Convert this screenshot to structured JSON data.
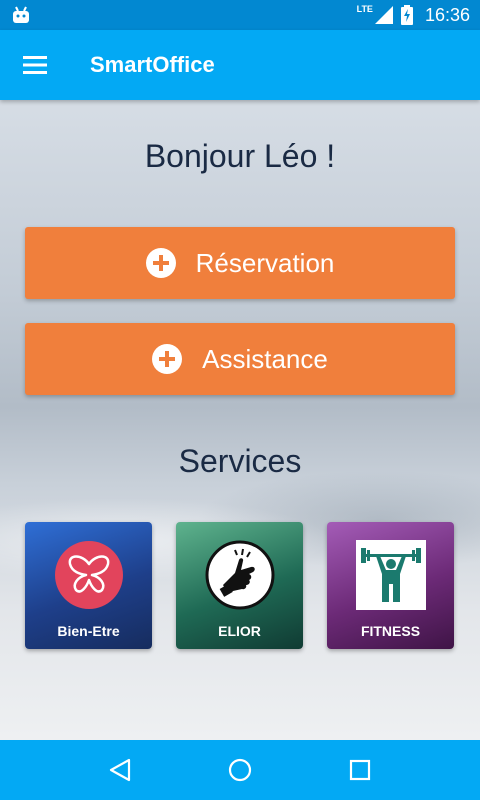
{
  "status_bar": {
    "network": "LTE",
    "time": "16:36"
  },
  "app_bar": {
    "title": "SmartOffice",
    "menu_icon": "hamburger-menu-icon"
  },
  "main": {
    "greeting": "Bonjour Léo !",
    "actions": [
      {
        "label": "Réservation",
        "icon": "plus-circle-icon"
      },
      {
        "label": "Assistance",
        "icon": "plus-circle-icon"
      }
    ],
    "services_title": "Services",
    "services": [
      {
        "label": "Bien-Etre",
        "icon": "butterfly-icon"
      },
      {
        "label": "ELIOR",
        "icon": "pointing-hand-icon"
      },
      {
        "label": "FITNESS",
        "icon": "weightlifter-icon"
      }
    ]
  },
  "nav_bar": {
    "buttons": [
      "back-icon",
      "home-icon",
      "recents-icon"
    ]
  },
  "colors": {
    "primary": "#03a9f4",
    "primary_dark": "#0288d1",
    "accent": "#f07f3c",
    "text_dark": "#1a2a44"
  }
}
